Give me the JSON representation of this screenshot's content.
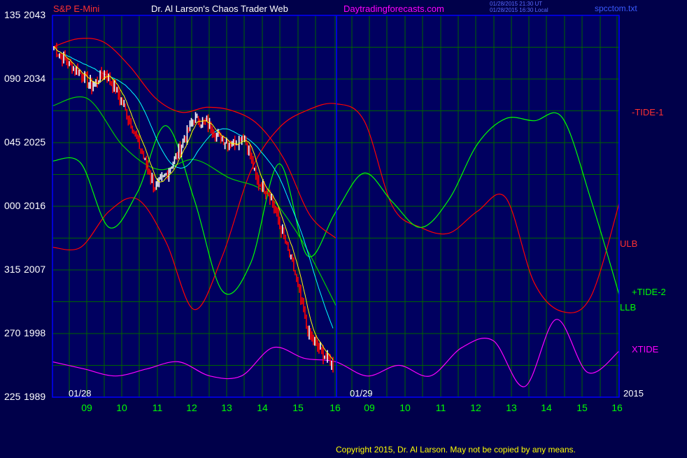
{
  "header": {
    "instrument": "S&P E-Mini",
    "title": "Dr. Al Larson's Chaos Trader Web",
    "site": "Daytradingforecasts.com",
    "stamp1": "01/28/2015 21:30 UT",
    "stamp2": "01/28/2015 16:30 Local",
    "file": "spcctom.txt"
  },
  "footer": {
    "copyright": "Copyright 2015, Dr. Al Larson. May not be copied by any means."
  },
  "colors": {
    "background": "#00004a",
    "plot_border": "#0000ff",
    "grid": "#006400",
    "price_up": "#ffffff",
    "price_down": "#ff0000",
    "tide_minus1": "#ff0000",
    "tide_plus2": "#00ff00",
    "ulb": "#ff0000",
    "llb": "#00cc00",
    "xtide": "#ff00ff",
    "ma_fast": "#ffff00",
    "ma_slow": "#00ffff",
    "label_red": "#ff3030",
    "label_green": "#00ff00",
    "label_white": "#ffffff",
    "label_magenta": "#ff00ff"
  },
  "chart_data": {
    "type": "line",
    "ylim": [
      1989,
      2043
    ],
    "left_ticks": [
      {
        "cycle": "135",
        "price": "2043"
      },
      {
        "cycle": "090",
        "price": "2034"
      },
      {
        "cycle": "045",
        "price": "2025"
      },
      {
        "cycle": "000",
        "price": "2016"
      },
      {
        "cycle": "315",
        "price": "2007"
      },
      {
        "cycle": "270",
        "price": "1998"
      },
      {
        "cycle": "225",
        "price": "1989"
      }
    ],
    "x_hours": [
      9,
      10,
      11,
      12,
      13,
      14,
      15,
      16,
      9,
      10,
      11,
      12,
      13,
      14,
      15,
      16
    ],
    "x_tick_labels": [
      "09",
      "10",
      "11",
      "12",
      "13",
      "14",
      "15",
      "16",
      "09",
      "10",
      "11",
      "12",
      "13",
      "14",
      "15",
      "16"
    ],
    "day_labels": [
      "01/28",
      "01/29"
    ],
    "year_label": "2015",
    "series": [
      {
        "name": "-TIDE-1",
        "values": [
          2010.2,
          2010.2,
          2015.3,
          2017.0,
          2011.0,
          2001.4,
          2009.0,
          2021.0,
          2027.1,
          2029.6,
          2030.5,
          2028.1,
          2016.0,
          2013.0,
          2012.2,
          2015.3,
          2017.2,
          2005.2,
          2001.1,
          2003.2,
          2016.4
        ]
      },
      {
        "name": "+TIDE-2",
        "values": [
          2022.4,
          2022.1,
          2013.0,
          2018.0,
          2027.4,
          2017.0,
          2004.0,
          2008.0,
          2022.0,
          2009.0,
          2015.2,
          2020.7,
          2016.6,
          2013.0,
          2017.0,
          2024.8,
          2028.4,
          2028.1,
          2028.5,
          2017.0,
          2003.5
        ]
      },
      {
        "name": "XTIDE",
        "values": [
          1994.0,
          1993.0,
          1992.0,
          1993.0,
          1994.0,
          1992.0,
          1992.0,
          1996.0,
          1994.5,
          1994.0,
          1992.0,
          1993.5,
          1992.0,
          1996.0,
          1997.0,
          1990.5,
          2000.0,
          1992.5,
          1995.5
        ]
      },
      {
        "name": "ULB",
        "values": [
          2038.5,
          2039.7,
          2039.2,
          2035.8,
          2031.3,
          2029.3,
          2030.0,
          2029.5,
          2027.5,
          2022.6,
          2014.7,
          2011.5
        ]
      },
      {
        "name": "LLB",
        "values": [
          2030.2,
          2031.2,
          2024.5,
          2021.2,
          2022.6,
          2020.0,
          2018.0,
          2011.5,
          2002.0
        ]
      },
      {
        "name": "Price",
        "values": [
          2038.5,
          2036.4,
          2034.9,
          2033.0,
          2035.0,
          2032.2,
          2028.0,
          2023.2,
          2018.5,
          2021.0,
          2024.4,
          2028.4,
          2027.8,
          2025.9,
          2024.8,
          2026.1,
          2019.5,
          2017.8,
          2012.2,
          2006.5,
          1998.3,
          1995.5,
          1993.6
        ]
      }
    ]
  },
  "labels": {
    "tide1": "-TIDE-1",
    "ulb": "ULB",
    "tide2": "+TIDE-2",
    "llb": "LLB",
    "xtide": "XTIDE"
  }
}
